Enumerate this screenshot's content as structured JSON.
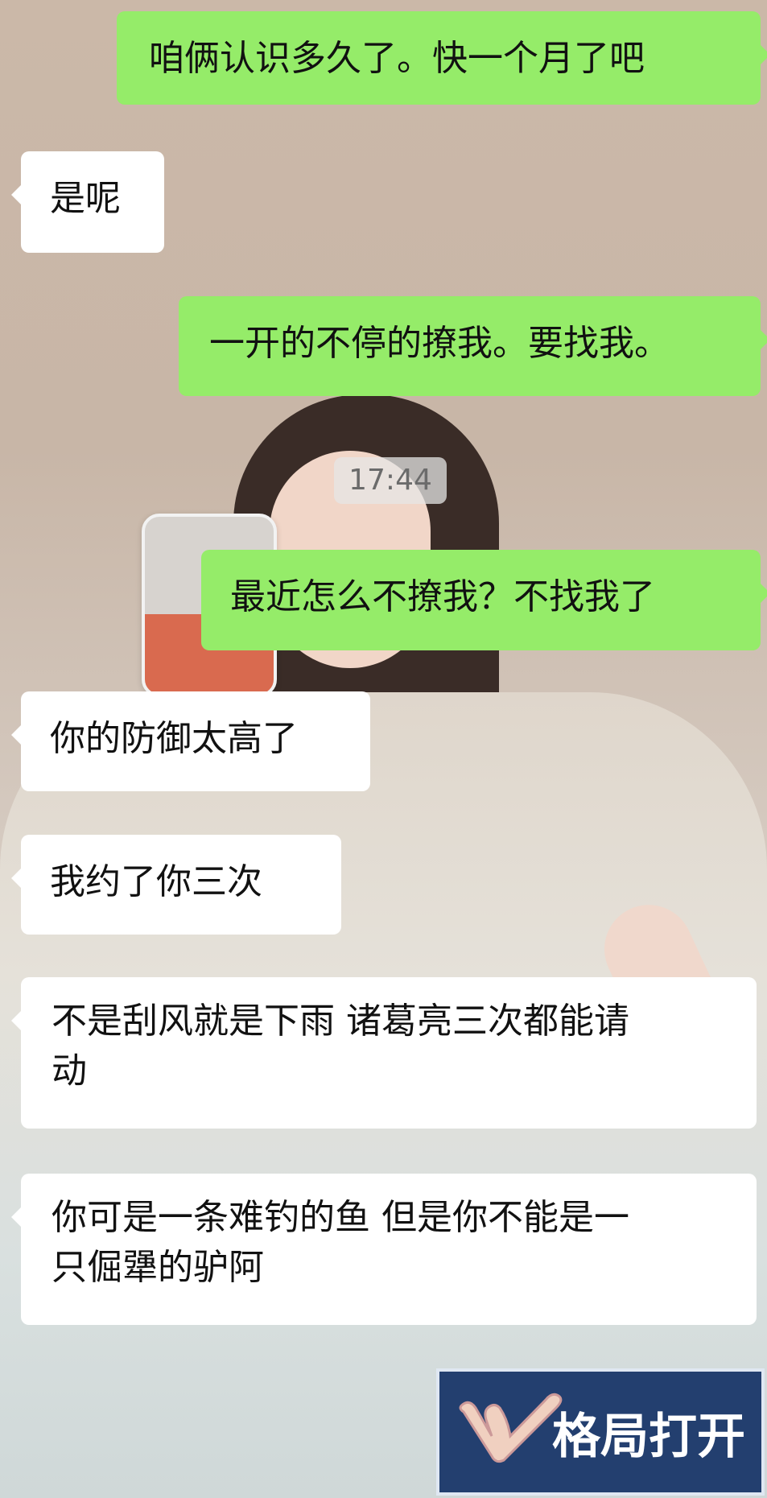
{
  "chat": {
    "messages": [
      {
        "side": "me",
        "text": "咱俩认识多久了。快一个月了吧"
      },
      {
        "side": "them",
        "text": "是呢"
      },
      {
        "side": "me",
        "text": "一开的不停的撩我。要找我。"
      },
      {
        "side": "me",
        "text": "最近怎么不撩我？不找我了"
      },
      {
        "side": "them",
        "text": "你的防御太高了"
      },
      {
        "side": "them",
        "text": "我约了你三次"
      },
      {
        "side": "them",
        "text": "不是刮风就是下雨 诸葛亮三次都能请\n动"
      },
      {
        "side": "them",
        "text": "你可是一条难钓的鱼 但是你不能是一\n只倔犟的驴阿"
      }
    ],
    "timestamp": "17:44"
  },
  "watermark": {
    "text": "格局打开",
    "icon": "hand-gesture-icon"
  },
  "colors": {
    "me_bubble": "#95ec69",
    "them_bubble": "#ffffff",
    "badge_bg": "#233f6f"
  }
}
